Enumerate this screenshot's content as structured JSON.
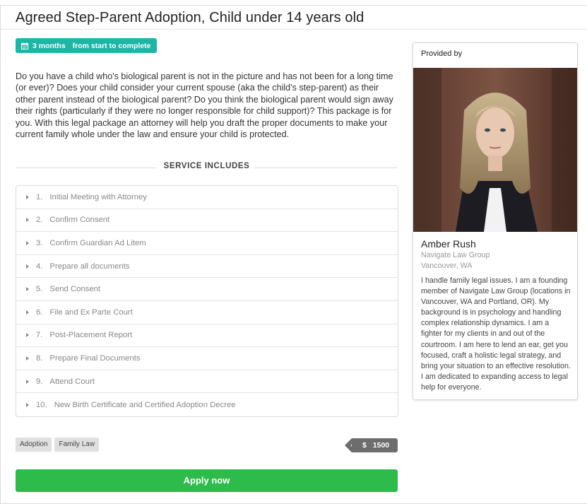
{
  "title": "Agreed Step-Parent Adoption, Child under 14 years old",
  "duration": {
    "icon": "calendar-icon",
    "value": "3 months",
    "suffix": "from start to complete",
    "color": "#1cb5a6"
  },
  "description": "Do you have a child who's biological parent is not in the picture and has not been for a long time (or ever)? Does your child consider your current spouse (aka the child's step-parent) as their other parent instead of the biological parent? Do you think the biological parent would sign away their rights (particularly if they were no longer responsible for child support)? This package is for you. With this legal package an attorney will help you draft the proper documents to make your current family whole under the law and ensure your child is protected.",
  "service_includes_label": "SERVICE INCLUDES",
  "steps": [
    {
      "num": "1.",
      "label": "Initial Meeting with Attorney"
    },
    {
      "num": "2.",
      "label": "Confirm Consent"
    },
    {
      "num": "3.",
      "label": "Confirm Guardian Ad Litem"
    },
    {
      "num": "4.",
      "label": "Prepare all documents"
    },
    {
      "num": "5.",
      "label": "Send Consent"
    },
    {
      "num": "6.",
      "label": "File and Ex Parte Court"
    },
    {
      "num": "7.",
      "label": "Post-Placement Report"
    },
    {
      "num": "8.",
      "label": "Prepare Final Documents"
    },
    {
      "num": "9.",
      "label": "Attend Court"
    },
    {
      "num": "10.",
      "label": "New Birth Certificate and Certified Adoption Decree"
    }
  ],
  "tags": [
    "Adoption",
    "Family Law"
  ],
  "price": {
    "currency": "$",
    "amount": "1500"
  },
  "apply_label": "Apply now",
  "apply_color": "#2dbb4a",
  "provider": {
    "header": "Provided by",
    "name": "Amber Rush",
    "firm": "Navigate Law Group",
    "location": "Vancouver, WA",
    "bio": "I handle family legal issues. I am a founding member of Navigate Law Group (locations in Vancouver, WA and Portland, OR). My background is in psychology and handling complex relationship dynamics. I am a fighter for my clients in and out of the courtroom. I am here to lend an ear, get you focused, craft a holistic legal strategy, and bring your situation to an effective resolution. I am dedicated to expanding access to legal help for everyone."
  }
}
